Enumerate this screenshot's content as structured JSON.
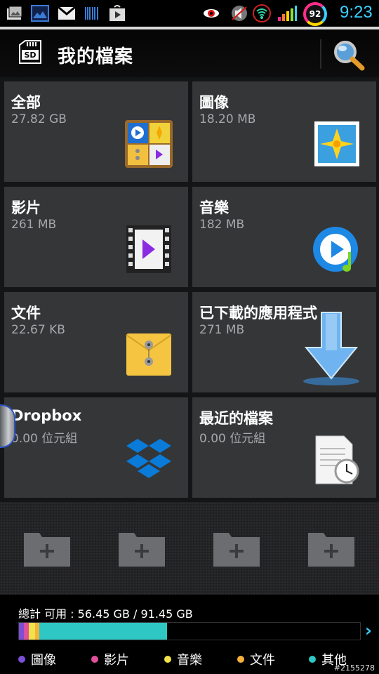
{
  "status_bar": {
    "battery_level": "92",
    "time": "9:23",
    "icons": [
      "gallery-icon",
      "photo-icon",
      "gmail-icon",
      "barcode-icon",
      "play-store-icon",
      "eye-icon",
      "mute-icon",
      "wifi-icon",
      "signal-icon"
    ]
  },
  "header": {
    "title": "我的檔案",
    "sd_label": "SD",
    "icons": [
      "sd-card-icon",
      "search-icon"
    ]
  },
  "tiles": [
    {
      "name": "全部",
      "size": "27.82 GB",
      "icon": "all-files-icon"
    },
    {
      "name": "圖像",
      "size": "18.20 MB",
      "icon": "image-icon"
    },
    {
      "name": "影片",
      "size": "261 MB",
      "icon": "video-icon"
    },
    {
      "name": "音樂",
      "size": "182 MB",
      "icon": "music-icon"
    },
    {
      "name": "文件",
      "size": "22.67 KB",
      "icon": "document-icon"
    },
    {
      "name": "已下載的應用程式",
      "size": "271 MB",
      "icon": "download-icon"
    },
    {
      "name": "Dropbox",
      "size": "0.00 位元組",
      "icon": "dropbox-icon"
    },
    {
      "name": "最近的檔案",
      "size": "0.00 位元組",
      "icon": "recent-files-icon"
    }
  ],
  "folders": [
    "add-folder-shortcut",
    "add-folder-shortcut",
    "add-folder-shortcut",
    "add-folder-shortcut"
  ],
  "storage": {
    "summary": "總計 可用 : 56.45 GB / 91.45 GB",
    "segments": [
      {
        "category": "圖像",
        "color": "#7b4fd6",
        "fraction": 0.014
      },
      {
        "category": "影片",
        "color": "#e0509b",
        "fraction": 0.014
      },
      {
        "category": "音樂",
        "color": "#f2e24a",
        "fraction": 0.02
      },
      {
        "category": "文件",
        "color": "#f5b23a",
        "fraction": 0.012
      },
      {
        "category": "其他",
        "color": "#2ec7c4",
        "fraction": 0.375
      }
    ],
    "legend": [
      {
        "label": "圖像",
        "color": "#7b4fd6"
      },
      {
        "label": "影片",
        "color": "#e0509b"
      },
      {
        "label": "音樂",
        "color": "#f2e24a"
      },
      {
        "label": "文件",
        "color": "#f5b23a"
      },
      {
        "label": "其他",
        "color": "#2ec7c4"
      }
    ]
  },
  "watermark": "#2155278"
}
